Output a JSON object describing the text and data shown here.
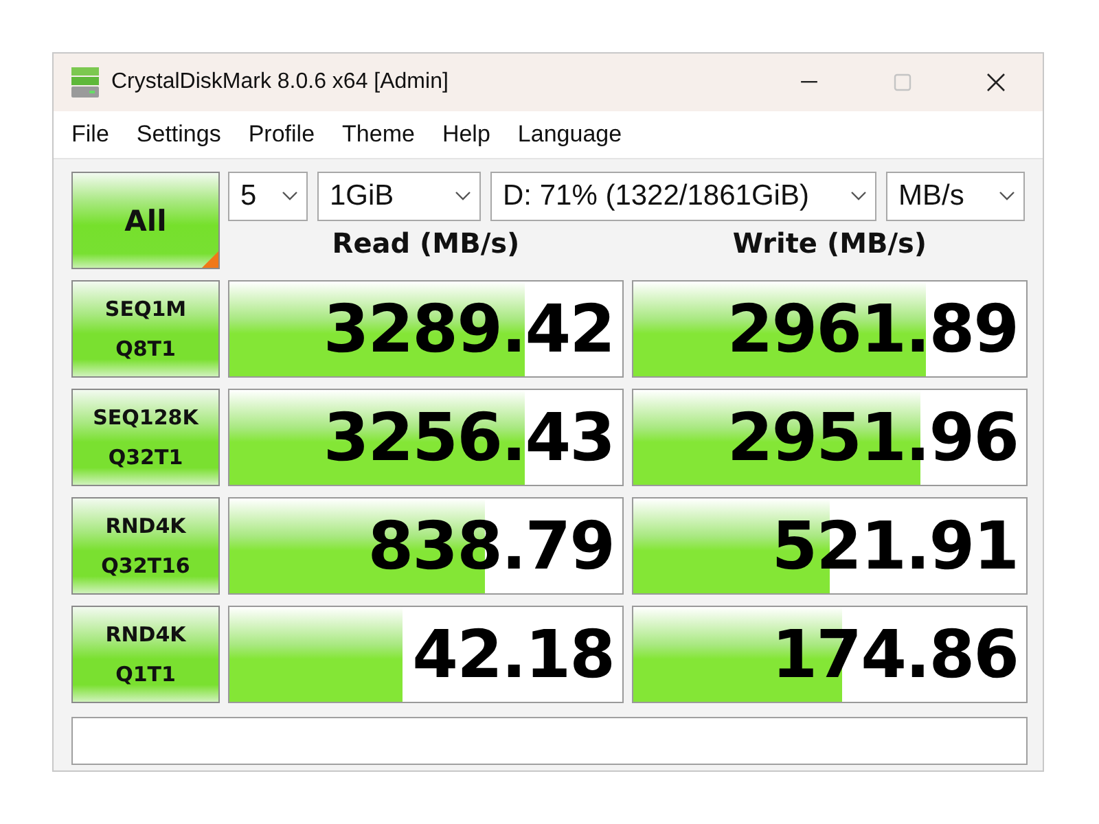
{
  "window": {
    "title": "CrystalDiskMark 8.0.6 x64 [Admin]",
    "controls": [
      {
        "kind": "minimize",
        "disabled": false
      },
      {
        "kind": "maximize",
        "disabled": true
      },
      {
        "kind": "close",
        "disabled": false
      }
    ]
  },
  "menu": [
    "File",
    "Settings",
    "Profile",
    "Theme",
    "Help",
    "Language"
  ],
  "all_button": {
    "label": "All"
  },
  "selectors": [
    {
      "value": "5"
    },
    {
      "value": "1GiB"
    },
    {
      "value": "D: 71% (1322/1861GiB)"
    },
    {
      "value": "MB/s"
    }
  ],
  "columns": [
    "Read (MB/s)",
    "Write (MB/s)"
  ],
  "tests": [
    {
      "label": [
        "SEQ1M",
        "Q8T1"
      ],
      "read": {
        "value": "3289.42",
        "level": 0.75
      },
      "write": {
        "value": "2961.89",
        "level": 0.745
      }
    },
    {
      "label": [
        "SEQ128K",
        "Q32T1"
      ],
      "read": {
        "value": "3256.43",
        "level": 0.75
      },
      "write": {
        "value": "2951.96",
        "level": 0.73
      }
    },
    {
      "label": [
        "RND4K",
        "Q32T16"
      ],
      "read": {
        "value": "838.79",
        "level": 0.65
      },
      "write": {
        "value": "521.91",
        "level": 0.5
      }
    },
    {
      "label": [
        "RND4K",
        "Q1T1"
      ],
      "read": {
        "value": "42.18",
        "level": 0.44
      },
      "write": {
        "value": "174.86",
        "level": 0.53
      }
    }
  ]
}
